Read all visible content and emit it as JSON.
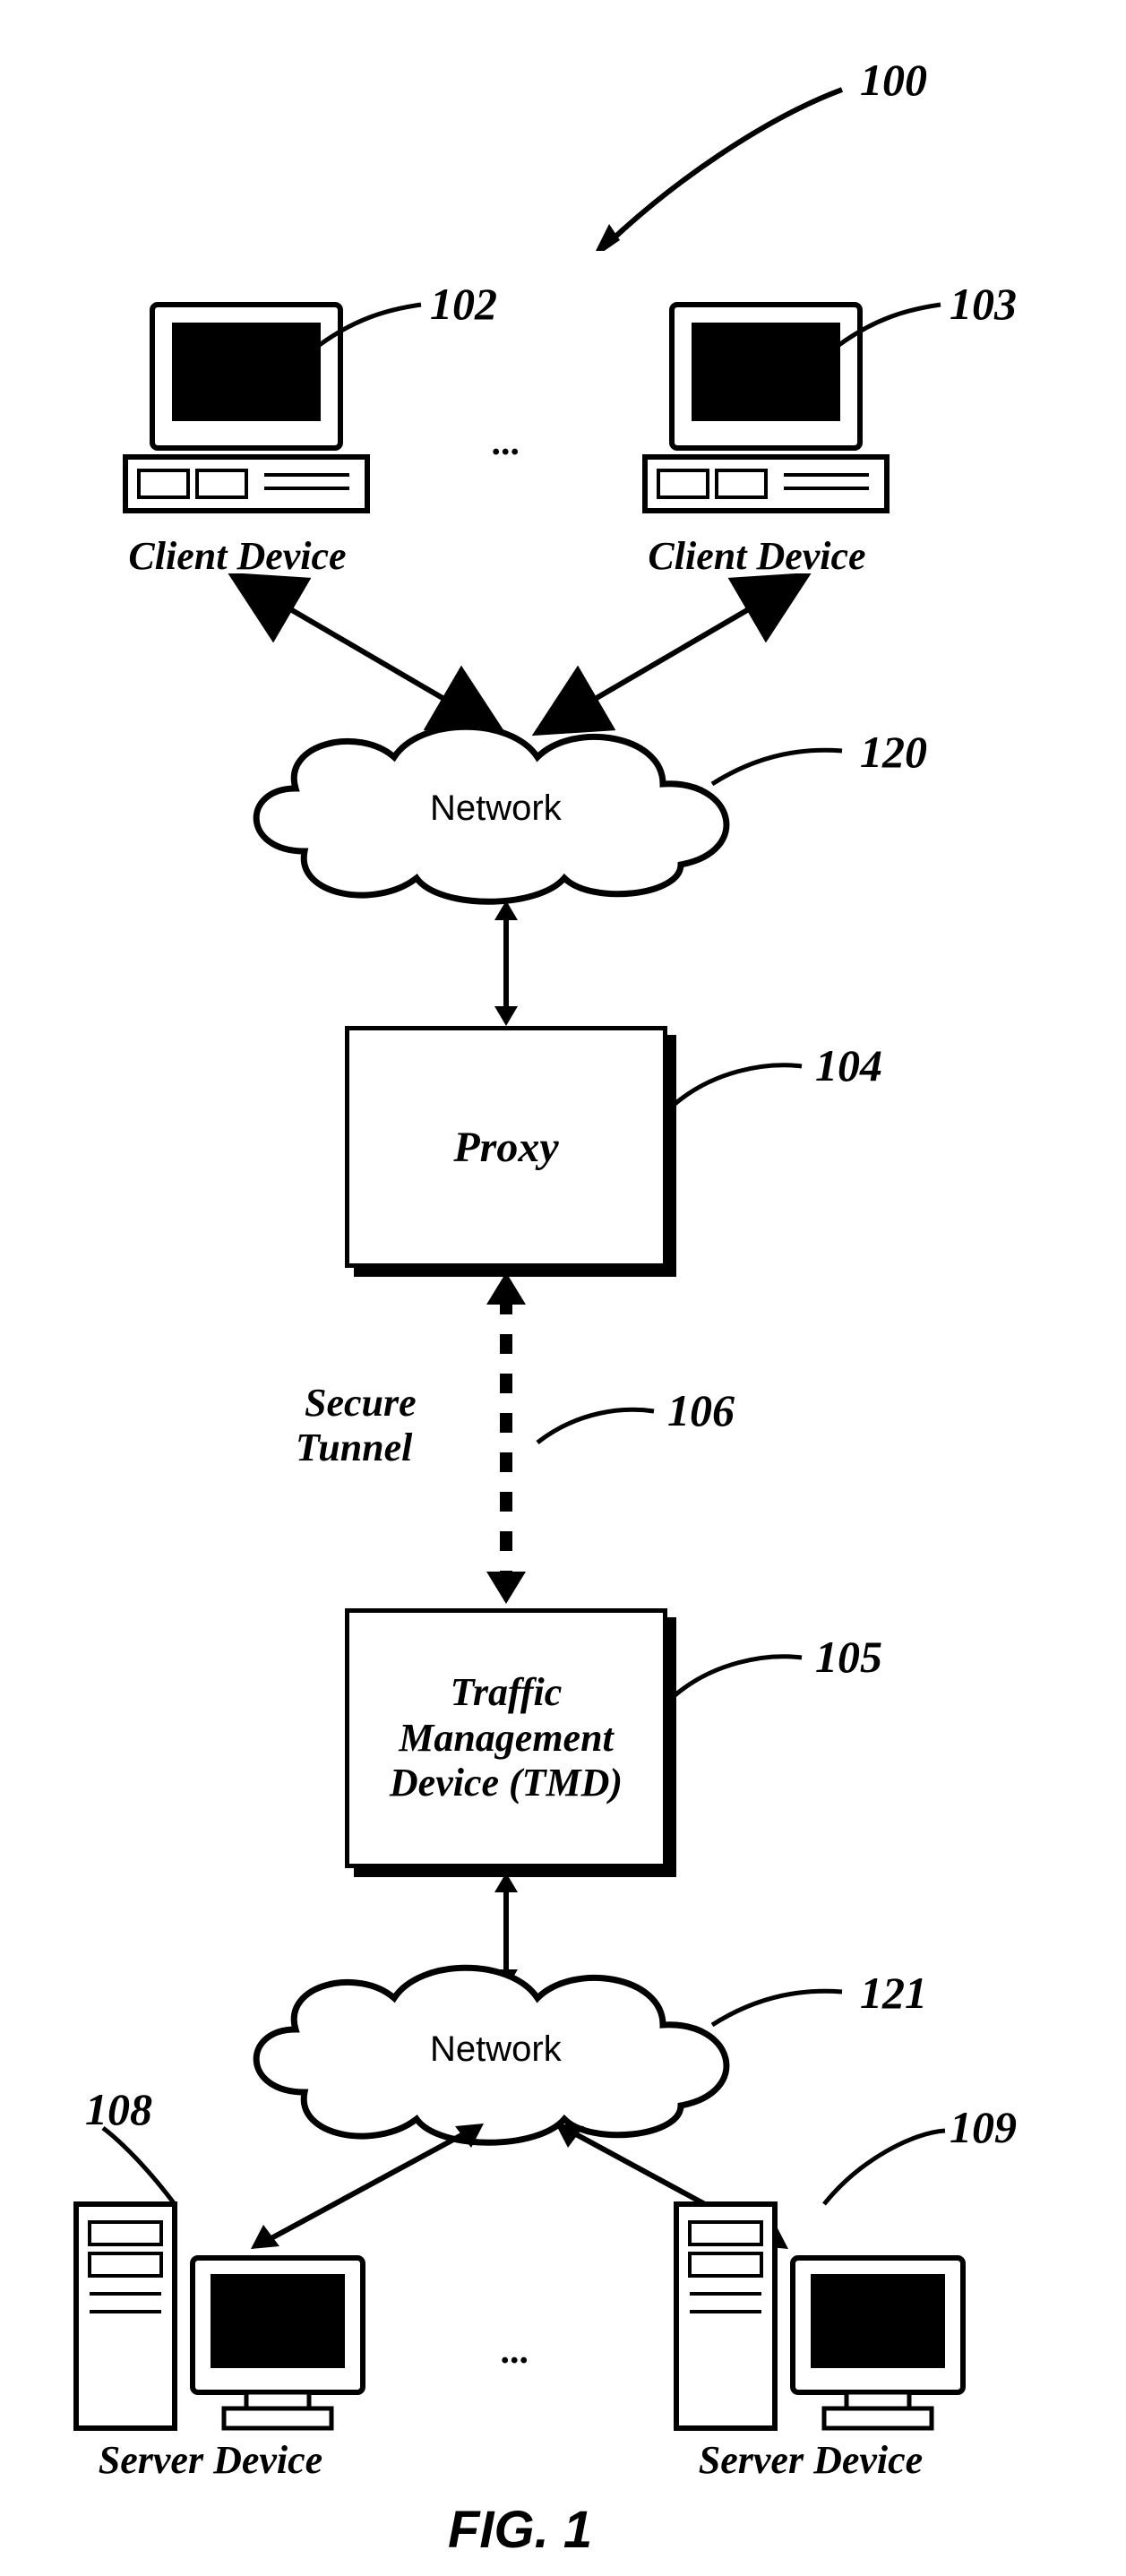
{
  "refs": {
    "figure": "100",
    "client_left": "102",
    "client_right": "103",
    "network_top": "120",
    "proxy": "104",
    "tunnel": "106",
    "tmd": "105",
    "network_bottom": "121",
    "server_left": "108",
    "server_right": "109"
  },
  "labels": {
    "client_device": "Client Device",
    "server_device": "Server Device",
    "network": "Network",
    "proxy": "Proxy",
    "secure_tunnel_l1": "Secure",
    "secure_tunnel_l2": "Tunnel",
    "tmd_l1": "Traffic",
    "tmd_l2": "Management",
    "tmd_l3": "Device (TMD)",
    "ellipsis": "...",
    "caption": "FIG. 1"
  }
}
